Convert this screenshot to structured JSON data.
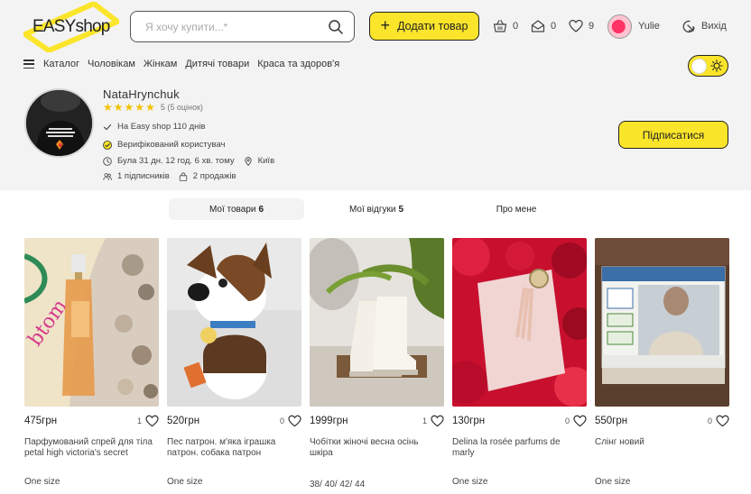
{
  "header": {
    "logo_text": "EASYshop",
    "search_placeholder": "Я хочу купити...*",
    "add_button_label": "Додати товар",
    "cart_count": "0",
    "messages_count": "0",
    "favorites_count": "9",
    "user_name": "Yulie",
    "logout_label": "Вихід"
  },
  "nav": {
    "items": [
      "Каталог",
      "Чоловікам",
      "Жінкам",
      "Дитячі товари",
      "Краса та здоров'я"
    ]
  },
  "profile": {
    "name": "NataHrynchuk",
    "rating_text": "5 (5 оцінок)",
    "stars": 5,
    "on_site": "На Easy shop 110 днів",
    "verified": "Верифікований користувач",
    "last_seen": "Була 31 дн. 12 год. 6 хв. тому",
    "city": "Київ",
    "followers": "1 підписників",
    "sales": "2 продажів",
    "subscribe_label": "Підписатися"
  },
  "tabs": [
    {
      "label": "Мої товари",
      "count": "6"
    },
    {
      "label": "Мої відгуки",
      "count": "5"
    },
    {
      "label": "Про мене",
      "count": ""
    }
  ],
  "products": [
    {
      "price": "475грн",
      "likes": "1",
      "title": "Парфумований спрей для тіла petal high victoria's secret",
      "size": "One size"
    },
    {
      "price": "520грн",
      "likes": "0",
      "title": "Пес патрон. м'яка іграшка патрон. собака патрон",
      "size": "One size"
    },
    {
      "price": "1999грн",
      "likes": "1",
      "title": "Чобітки жіночі весна осінь шкіра",
      "size": "38/ 40/ 42/ 44"
    },
    {
      "price": "130грн",
      "likes": "0",
      "title": "Delina la rosée parfums de marly",
      "size": "One size"
    },
    {
      "price": "550грн",
      "likes": "0",
      "title": "Слінг новий",
      "size": "One size"
    }
  ],
  "colors": {
    "accent": "#fbe52b",
    "background_top": "#f3f3f3",
    "star": "#f2c200"
  }
}
